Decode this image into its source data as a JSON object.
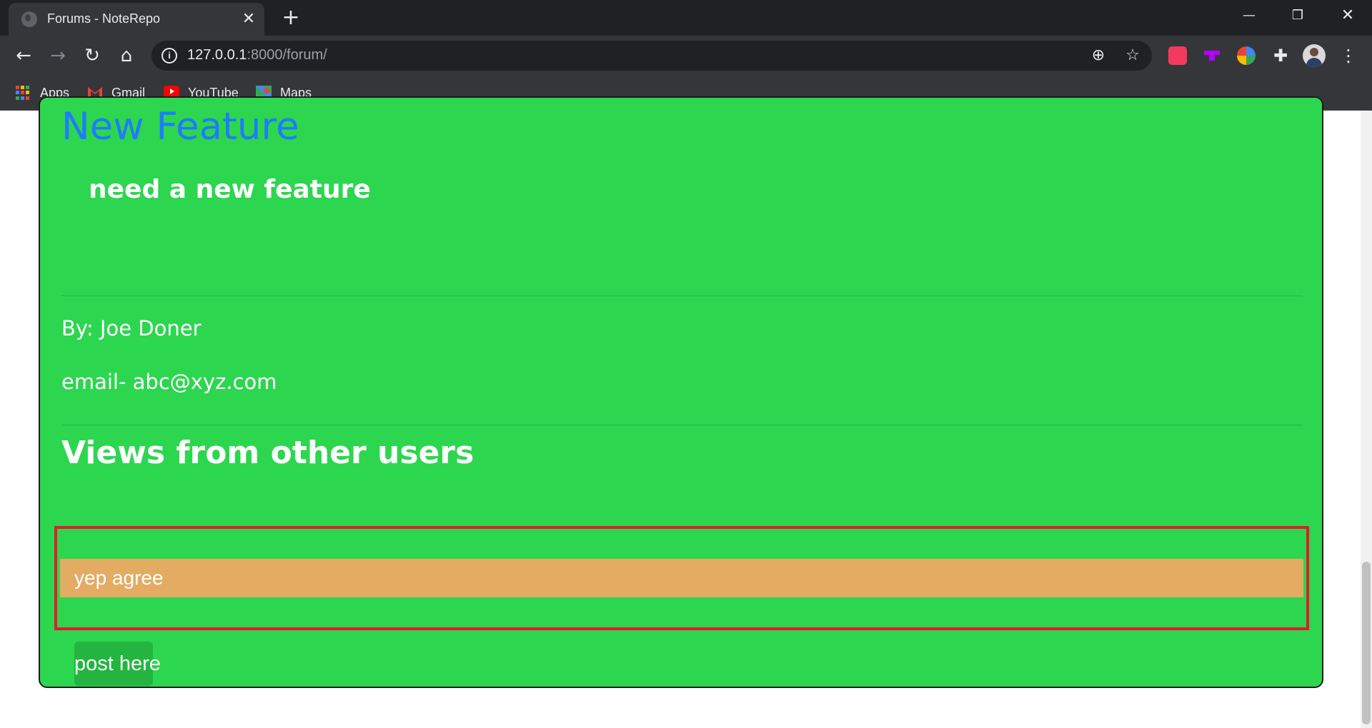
{
  "browser": {
    "tab_title": "Forums - NoteRepo",
    "url_host": "127.0.0.1",
    "url_path": ":8000/forum/",
    "bookmarks": [
      "Apps",
      "Gmail",
      "YouTube",
      "Maps"
    ]
  },
  "post": {
    "title": "New Feature",
    "description": "need a new feature",
    "author": "By: Joe Doner",
    "email": "email- abc@xyz.com"
  },
  "comments_section": {
    "heading": "Views from other users",
    "comments": [
      "yep agree"
    ],
    "post_button": "post here"
  },
  "colors": {
    "card_background": "#2dd64f",
    "title_color": "#1f7bff",
    "comment_background": "#e3ac62",
    "highlight_border": "#e21b2b",
    "button_background": "#23b53f"
  }
}
